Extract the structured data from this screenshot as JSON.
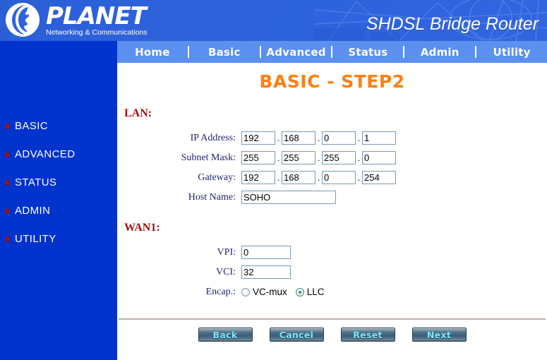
{
  "brand": {
    "name": "PLANET",
    "tagline": "Networking & Communications",
    "logo_icon": "planet-moon-face-logo",
    "product_title": "SHDSL Bridge Router",
    "header_color": "#2f63dc"
  },
  "nav": {
    "items": [
      {
        "label": "Home"
      },
      {
        "label": "Basic"
      },
      {
        "label": "Advanced"
      },
      {
        "label": "Status"
      },
      {
        "label": "Admin"
      },
      {
        "label": "Utility"
      }
    ],
    "background_color": "#5b8ff0"
  },
  "sidebar": {
    "background_color": "#0033cc",
    "bullet_icon": "triangle-right-icon",
    "bullet_color": "#a01010",
    "items": [
      {
        "label": "BASIC"
      },
      {
        "label": "ADVANCED"
      },
      {
        "label": "STATUS"
      },
      {
        "label": "ADMIN"
      },
      {
        "label": "UTILITY"
      }
    ]
  },
  "main": {
    "page_title": "BASIC - STEP2",
    "page_title_color": "#ff7f11",
    "section_color": "#a01010",
    "lan": {
      "heading": "LAN:",
      "ip_address": {
        "label": "IP Address:",
        "octets": [
          "192",
          "168",
          "0",
          "1"
        ]
      },
      "subnet_mask": {
        "label": "Subnet Mask:",
        "octets": [
          "255",
          "255",
          "255",
          "0"
        ]
      },
      "gateway": {
        "label": "Gateway:",
        "octets": [
          "192",
          "168",
          "0",
          "254"
        ]
      },
      "host_name": {
        "label": "Host Name:",
        "value": "SOHO"
      },
      "separator": "."
    },
    "wan1": {
      "heading": "WAN1:",
      "vpi": {
        "label": "VPI:",
        "value": "0"
      },
      "vci": {
        "label": "VCI:",
        "value": "32"
      },
      "encap": {
        "label": "Encap.:",
        "options": [
          {
            "label": "VC-mux",
            "selected": false
          },
          {
            "label": "LLC",
            "selected": true
          }
        ]
      }
    },
    "buttons": [
      {
        "label": "Back"
      },
      {
        "label": "Cancel"
      },
      {
        "label": "Reset"
      },
      {
        "label": "Next"
      }
    ]
  }
}
